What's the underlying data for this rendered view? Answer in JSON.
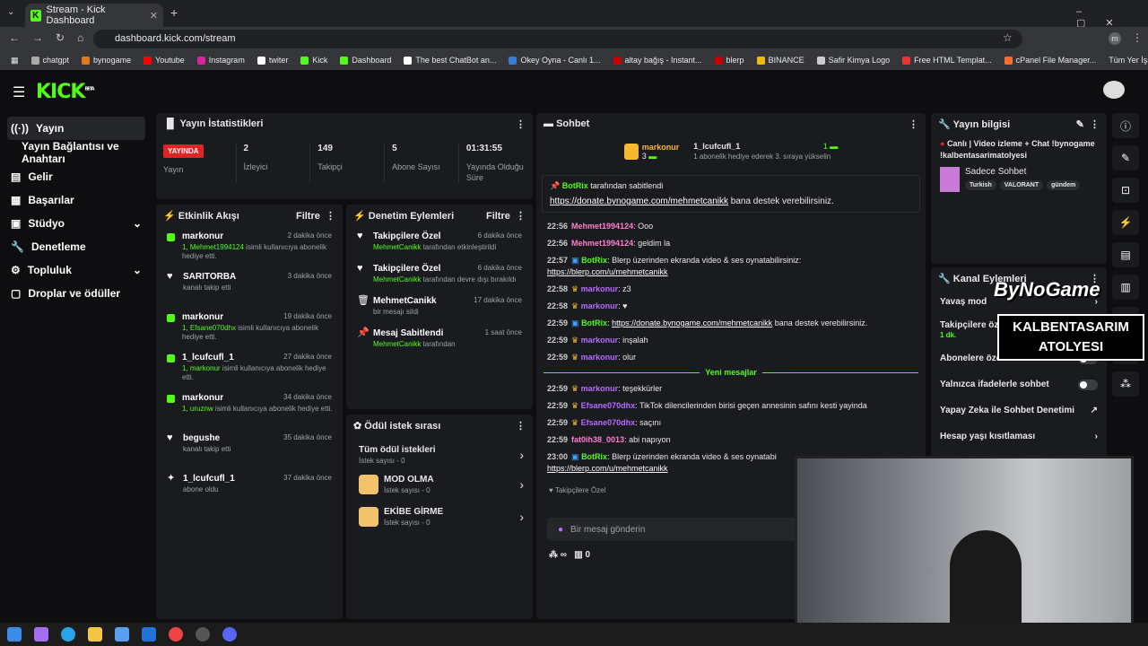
{
  "browser": {
    "tab_title": "Stream - Kick Dashboard",
    "url": "dashboard.kick.com/stream",
    "profile": "m",
    "bookmarks": [
      "chatgpt",
      "bynogame",
      "Youtube",
      "Instagram",
      "twiter",
      "Kick",
      "Dashboard",
      "The best ChatBot an...",
      "Okey Oyna - Canlı 1...",
      "altay bağış - Instant...",
      "blerp",
      "BINANCE",
      "Safir Kimya Logo",
      "Free HTML Templat...",
      "cPanel File Manager..."
    ],
    "all_bookmarks": "Tüm Yer İşaretleri"
  },
  "app": {
    "logo": "KICK",
    "beta": "BETA"
  },
  "sidebar": {
    "items": [
      {
        "label": "Yayın"
      },
      {
        "label": "Yayın Bağlantısı ve Anahtarı"
      },
      {
        "label": "Gelir"
      },
      {
        "label": "Başarılar"
      },
      {
        "label": "Stüdyo"
      },
      {
        "label": "Denetleme"
      },
      {
        "label": "Topluluk"
      },
      {
        "label": "Droplar ve ödüller"
      }
    ]
  },
  "stats": {
    "title": "Yayın İstatistikleri",
    "live_badge": "YAYINDA",
    "live_label": "Yayın",
    "items": [
      {
        "value": "2",
        "label": "İzleyici"
      },
      {
        "value": "149",
        "label": "Takipçi"
      },
      {
        "value": "5",
        "label": "Abone Sayısı"
      },
      {
        "value": "01:31:55",
        "label": "Yayında Olduğu Süre"
      }
    ]
  },
  "activity": {
    "title": "Etkinlik Akışı",
    "filter": "Filtre",
    "events": [
      {
        "user": "markonur",
        "time": "2 dakika önce",
        "desc_hl": "1, Mehmet1994124",
        "desc": " isimli kullanıcıya abonelik hediye etti.",
        "icon": "gift"
      },
      {
        "user": "SARITORBA",
        "time": "3 dakika önce",
        "desc_hl": "",
        "desc": "kanalı takip etti",
        "icon": "heart"
      },
      {
        "user": "markonur",
        "time": "19 dakika önce",
        "desc_hl": "1, Efsane070dhx",
        "desc": " isimli kullanıcıya abonelik hediye etti.",
        "icon": "gift"
      },
      {
        "user": "1_lcufcufl_1",
        "time": "27 dakika önce",
        "desc_hl": "1, markonur",
        "desc": " isimli kullanıcıya abonelik hediye etti.",
        "icon": "gift"
      },
      {
        "user": "markonur",
        "time": "34 dakika önce",
        "desc_hl": "1, uruznw",
        "desc": " isimli kullanıcıya abonelik hediye etti.",
        "icon": "gift"
      },
      {
        "user": "begushe",
        "time": "35 dakika önce",
        "desc_hl": "",
        "desc": "kanalı takip etti",
        "icon": "heart"
      },
      {
        "user": "1_lcufcufl_1",
        "time": "37 dakika önce",
        "desc_hl": "",
        "desc": "abone oldu",
        "icon": "star"
      }
    ]
  },
  "moderation": {
    "title": "Denetim Eylemleri",
    "filter": "Filtre",
    "events": [
      {
        "title": "Takipçilere Özel",
        "time": "6 dakika önce",
        "hl": "MehmetCanikk",
        "desc": " tarafından etkinleştirildi",
        "icon": "heart"
      },
      {
        "title": "Takipçilere Özel",
        "time": "6 dakika önce",
        "hl": "MehmetCanikk",
        "desc": " tarafından devre dışı bırakıldı",
        "icon": "heart"
      },
      {
        "title": "MehmetCanikk",
        "time": "17 dakika önce",
        "hl": "",
        "desc": "bir mesajı sildi",
        "icon": "trash"
      },
      {
        "title": "Mesaj Sabitlendi",
        "time": "1 saat önce",
        "hl": "MehmetCanikk",
        "desc": " tarafından",
        "icon": "pin"
      }
    ]
  },
  "rewards": {
    "title": "Ödül istek sırası",
    "items": [
      {
        "title": "Tüm ödül istekleri",
        "sub": "İstek sayısı - 0"
      },
      {
        "title": "MOD OLMA",
        "sub": "İstek sayısı - 0"
      },
      {
        "title": "EKİBE GİRME",
        "sub": "İstek sayısı - 0"
      }
    ]
  },
  "chat": {
    "title": "Sohbet",
    "leader1": {
      "name": "markonur",
      "count": "3"
    },
    "leader2": {
      "name": "1_lcufcufl_1",
      "count": "1",
      "desc": "1 abonelik hediye ederek 3. sıraya yükselin"
    },
    "pinned": {
      "by": "BotRix",
      "by_suffix": " tarafından sabitlendi",
      "link": "https://donate.bynogame.com/mehmetcanikk",
      "text": " bana destek verebilirsiniz."
    },
    "messages": [
      {
        "ts": "22:56",
        "user": "Mehmet1994124",
        "color": "#ff7dd2",
        "text": "Ooo"
      },
      {
        "ts": "22:56",
        "user": "Mehmet1994124",
        "color": "#ff7dd2",
        "text": "geldim la"
      },
      {
        "ts": "22:57",
        "user": "BotRix",
        "color": "#53fc18",
        "text": "Blerp üzerinden ekranda video & ses oynatabilirsiniz:",
        "link": "https://blerp.com/u/mehmetcanikk"
      },
      {
        "ts": "22:58",
        "user": "markonur",
        "color": "#b66bff",
        "text": "z3"
      },
      {
        "ts": "22:58",
        "user": "markonur",
        "color": "#b66bff",
        "text": "♥"
      },
      {
        "ts": "22:59",
        "user": "BotRix",
        "color": "#53fc18",
        "link_inline": "https://donate.bynogame.com/mehmetcanikk",
        "text": " bana destek verebilirsiniz."
      },
      {
        "ts": "22:59",
        "user": "markonur",
        "color": "#b66bff",
        "text": "inşalah"
      },
      {
        "ts": "22:59",
        "user": "markonur",
        "color": "#b66bff",
        "text": "olur"
      }
    ],
    "new_label": "Yeni mesajlar",
    "messages2": [
      {
        "ts": "22:59",
        "user": "markonur",
        "color": "#b66bff",
        "text": "teşekkürler"
      },
      {
        "ts": "22:59",
        "user": "Efsane070dhx",
        "color": "#b66bff",
        "text": "TikTok dilencilerinden birisi geçen annesinin safını kesti yayinda"
      },
      {
        "ts": "22:59",
        "user": "Efsane070dhx",
        "color": "#b66bff",
        "text": "saçını"
      },
      {
        "ts": "22:59",
        "user": "fat0ih38_0013",
        "color": "#ff7dd2",
        "text": "abi napıyon"
      },
      {
        "ts": "23:00",
        "user": "BotRix",
        "color": "#53fc18",
        "text": "Blerp üzerinden ekranda video & ses oynatabi",
        "link": "https://blerp.com/u/mehmetcanikk"
      }
    ],
    "followers_only": "Takipçilere Özel",
    "input_placeholder": "Bir mesaj gönderin",
    "points": "∞",
    "count": "0"
  },
  "info": {
    "title": "Yayın bilgisi",
    "stream_title": "Canlı | Video izleme + Chat !bynogame !kalbentasarimatolyesi",
    "category": "Sadece Sohbet",
    "tags": [
      "Turkish",
      "VALORANT",
      "gündem"
    ]
  },
  "actions": {
    "title": "Kanal Eylemleri",
    "items": [
      {
        "label": "Yavaş mod",
        "kind": "chev"
      },
      {
        "label": "Takipçilere öz",
        "sub": "1 dk.",
        "kind": "chev"
      },
      {
        "label": "Abonelere öze",
        "kind": "toggle"
      },
      {
        "label": "Yalnızca ifadelerle sohbet",
        "kind": "toggle"
      },
      {
        "label": "Yapay Zeka ile Sohbet Denetimi",
        "kind": "ext"
      },
      {
        "label": "Hesap yaşı kısıtlaması",
        "kind": "chev"
      }
    ]
  },
  "overlay": {
    "brand": "ByNoGame",
    "line1": "KALBENTASARIM",
    "line2": "ATOLYESI"
  },
  "colors": {
    "accent": "#53fc18",
    "panel": "#191b1f",
    "bg": "#0e0e10"
  }
}
